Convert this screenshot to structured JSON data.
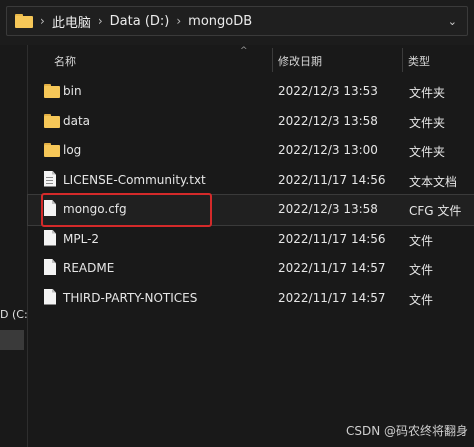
{
  "breadcrumb": [
    "此电脑",
    "Data (D:)",
    "mongoDB"
  ],
  "icons": {
    "address_folder": "folder-icon",
    "separator": "chevron-right-icon",
    "dropdown": "chevron-down-icon",
    "sort": "chevron-up-icon"
  },
  "columns": {
    "name": "名称",
    "date": "修改日期",
    "type": "类型"
  },
  "nav": {
    "drive_label": "D (C:)"
  },
  "files": [
    {
      "name": "bin",
      "date": "2022/12/3 13:53",
      "type": "文件夹",
      "icon": "folder-icon"
    },
    {
      "name": "data",
      "date": "2022/12/3 13:58",
      "type": "文件夹",
      "icon": "folder-icon"
    },
    {
      "name": "log",
      "date": "2022/12/3 13:00",
      "type": "文件夹",
      "icon": "folder-icon"
    },
    {
      "name": "LICENSE-Community.txt",
      "date": "2022/11/17 14:56",
      "type": "文本文档",
      "icon": "text-file-icon"
    },
    {
      "name": "mongo.cfg",
      "date": "2022/12/3 13:58",
      "type": "CFG 文件",
      "icon": "file-icon"
    },
    {
      "name": "MPL-2",
      "date": "2022/11/17 14:56",
      "type": "文件",
      "icon": "file-icon"
    },
    {
      "name": "README",
      "date": "2022/11/17 14:57",
      "type": "文件",
      "icon": "file-icon"
    },
    {
      "name": "THIRD-PARTY-NOTICES",
      "date": "2022/11/17 14:57",
      "type": "文件",
      "icon": "file-icon"
    }
  ],
  "watermark": "CSDN @码农终将翻身",
  "colors": {
    "background": "#191919",
    "folder": "#f6c758",
    "annotation": "#d42a2a"
  }
}
